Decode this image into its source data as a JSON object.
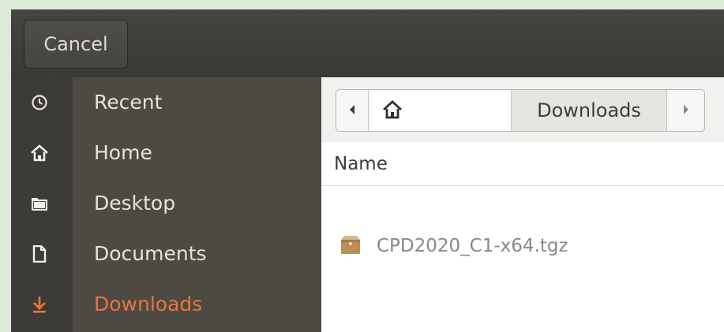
{
  "header": {
    "cancel_label": "Cancel"
  },
  "sidebar": {
    "items": [
      {
        "label": "Recent",
        "icon": "clock-icon"
      },
      {
        "label": "Home",
        "icon": "home-icon"
      },
      {
        "label": "Desktop",
        "icon": "folder-icon"
      },
      {
        "label": "Documents",
        "icon": "document-icon"
      },
      {
        "label": "Downloads",
        "icon": "download-icon",
        "active": true
      }
    ]
  },
  "pathbar": {
    "current": "Downloads",
    "home_icon": "home-icon"
  },
  "file_list": {
    "column_header": "Name",
    "files": [
      {
        "name": "CPD2020_C1-x64.tgz",
        "icon": "archive-icon"
      }
    ]
  },
  "colors": {
    "accent": "#e9743d",
    "sidebar_bg": "#4d4a44",
    "header_bg": "#3c3b37"
  }
}
